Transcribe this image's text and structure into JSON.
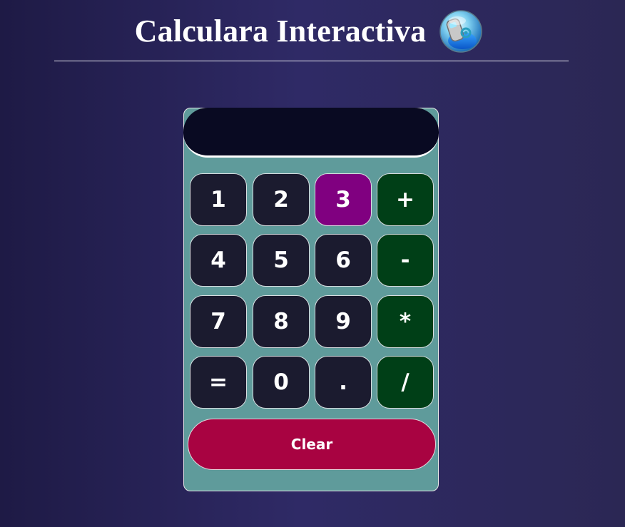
{
  "header": {
    "title": "Calculara Interactiva",
    "logo_icon": "calculator-globe-icon"
  },
  "display": {
    "value": ""
  },
  "keypad": {
    "rows": [
      [
        {
          "label": "1",
          "kind": "digit",
          "state": "normal"
        },
        {
          "label": "2",
          "kind": "digit",
          "state": "normal"
        },
        {
          "label": "3",
          "kind": "digit",
          "state": "active"
        },
        {
          "label": "+",
          "kind": "operator",
          "state": "normal"
        }
      ],
      [
        {
          "label": "4",
          "kind": "digit",
          "state": "normal"
        },
        {
          "label": "5",
          "kind": "digit",
          "state": "normal"
        },
        {
          "label": "6",
          "kind": "digit",
          "state": "normal"
        },
        {
          "label": "-",
          "kind": "operator",
          "state": "normal"
        }
      ],
      [
        {
          "label": "7",
          "kind": "digit",
          "state": "normal"
        },
        {
          "label": "8",
          "kind": "digit",
          "state": "normal"
        },
        {
          "label": "9",
          "kind": "digit",
          "state": "normal"
        },
        {
          "label": "*",
          "kind": "operator",
          "state": "normal"
        }
      ],
      [
        {
          "label": "=",
          "kind": "digit",
          "state": "normal"
        },
        {
          "label": "0",
          "kind": "digit",
          "state": "normal"
        },
        {
          "label": ".",
          "kind": "digit",
          "state": "normal"
        },
        {
          "label": "/",
          "kind": "operator",
          "state": "normal"
        }
      ]
    ],
    "clear_label": "Clear"
  },
  "colors": {
    "background_dark": "#1e1a45",
    "background_mid": "#2f2a66",
    "panel": "#5f9b9b",
    "display": "#090a22",
    "key": "#1b1b2f",
    "operator_key": "#003f17",
    "active_key": "#800080",
    "clear_key": "#a80341",
    "text": "#ffffff"
  }
}
